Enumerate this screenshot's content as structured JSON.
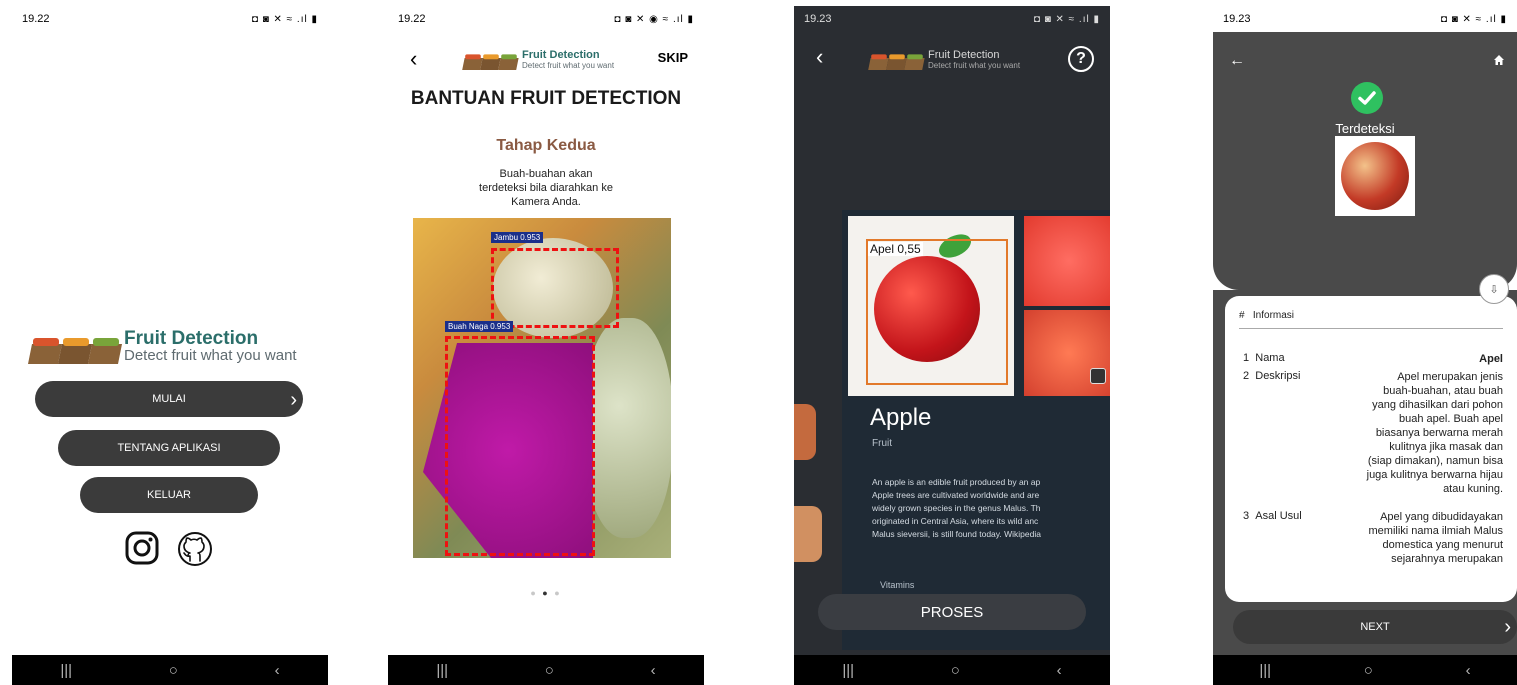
{
  "screen1": {
    "status_time": "19.22",
    "status_right": "◘ ◙ ✕ ≈ .ıl ▮",
    "logo_title": "Fruit Detection",
    "logo_subtitle": "Detect fruit what you want",
    "buttons": {
      "start": "MULAI",
      "about": "TENTANG APLIKASI",
      "exit": "KELUAR"
    },
    "nav": [
      "|||",
      "○",
      "‹"
    ]
  },
  "screen2": {
    "status_time": "19.22",
    "status_right": "◘ ◙ ✕ ◉ ≈ .ıl ▮",
    "back": "‹",
    "logo_title": "Fruit Detection",
    "logo_subtitle": "Detect fruit what you want",
    "skip": "SKIP",
    "title": "BANTUAN FRUIT DETECTION",
    "step": "Tahap Kedua",
    "desc_lines": [
      "Buah-buahan akan",
      "terdeteksi bila diarahkan ke",
      "Kamera Anda."
    ],
    "detections": [
      "Jambu 0.953",
      "Buah Naga 0.953"
    ],
    "nav": [
      "|||",
      "○",
      "‹"
    ]
  },
  "screen3": {
    "status_time": "19.23",
    "status_right": "◘ ◙ ✕ ≈ .ıl ▮",
    "back": "‹",
    "logo_title": "Fruit Detection",
    "logo_subtitle": "Detect fruit what you want",
    "help": "?",
    "detection_label": "Apel 0,55",
    "fruit_name": "Apple",
    "fruit_type": "Fruit",
    "desc_lines": [
      "An apple is an edible fruit produced by an ap",
      "Apple trees are cultivated worldwide and are",
      "widely grown species in the genus Malus. Th",
      "originated in Central Asia, where its wild anc",
      "Malus sieversii, is still found today. Wikipedia"
    ],
    "vitamins": "Vitamins",
    "process_button": "PROSES",
    "nav": [
      "|||",
      "○",
      "‹"
    ]
  },
  "screen4": {
    "status_time": "19.23",
    "status_right": "◘ ◙ ✕ ≈ .ıl ▮",
    "detected_label": "Terdeteksi",
    "table_header": {
      "num": "#",
      "label": "Informasi"
    },
    "rows": [
      {
        "num": "1",
        "key": "Nama",
        "value": "Apel"
      },
      {
        "num": "2",
        "key": "Deskripsi",
        "value_lines": [
          "Apel merupakan jenis",
          "buah-buahan, atau buah",
          "yang dihasilkan dari pohon",
          "buah apel. Buah apel",
          "biasanya berwarna merah",
          "kulitnya jika masak dan",
          "(siap dimakan), namun bisa",
          "juga kulitnya berwarna hijau",
          "atau kuning."
        ]
      },
      {
        "num": "3",
        "key": "Asal Usul",
        "value_lines": [
          "Apel yang dibudidayakan",
          "memiliki nama ilmiah Malus",
          "domestica yang menurut",
          "sejarahnya merupakan"
        ]
      }
    ],
    "next_button": "NEXT",
    "nav": [
      "|||",
      "○",
      "‹"
    ]
  }
}
